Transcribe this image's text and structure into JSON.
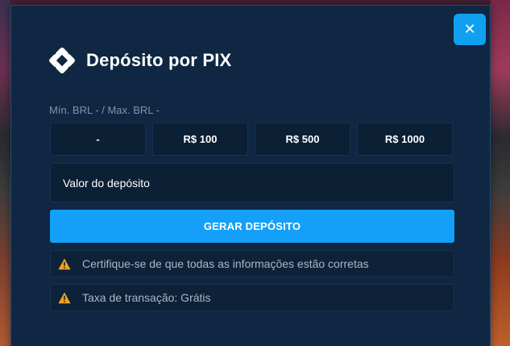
{
  "modal": {
    "title": "Depósito por PIX",
    "close_label": "✕",
    "limits_text": "Mín. BRL - / Max. BRL -",
    "amount_options": [
      "-",
      "R$ 100",
      "R$ 500",
      "R$ 1000"
    ],
    "deposit_input": {
      "placeholder": "Valor do depósito",
      "value": ""
    },
    "generate_button_label": "GERAR DEPÓSITO",
    "notices": [
      {
        "icon": "warning-icon",
        "text": "Certifique-se de que todas as informações estão corretas"
      },
      {
        "icon": "warning-icon",
        "text": "Taxa de transação: Grátis"
      }
    ]
  },
  "colors": {
    "modal_bg": "#0f2742",
    "accent": "#14a0f8",
    "warning": "#f0a020",
    "muted_text": "#7f94ab"
  }
}
